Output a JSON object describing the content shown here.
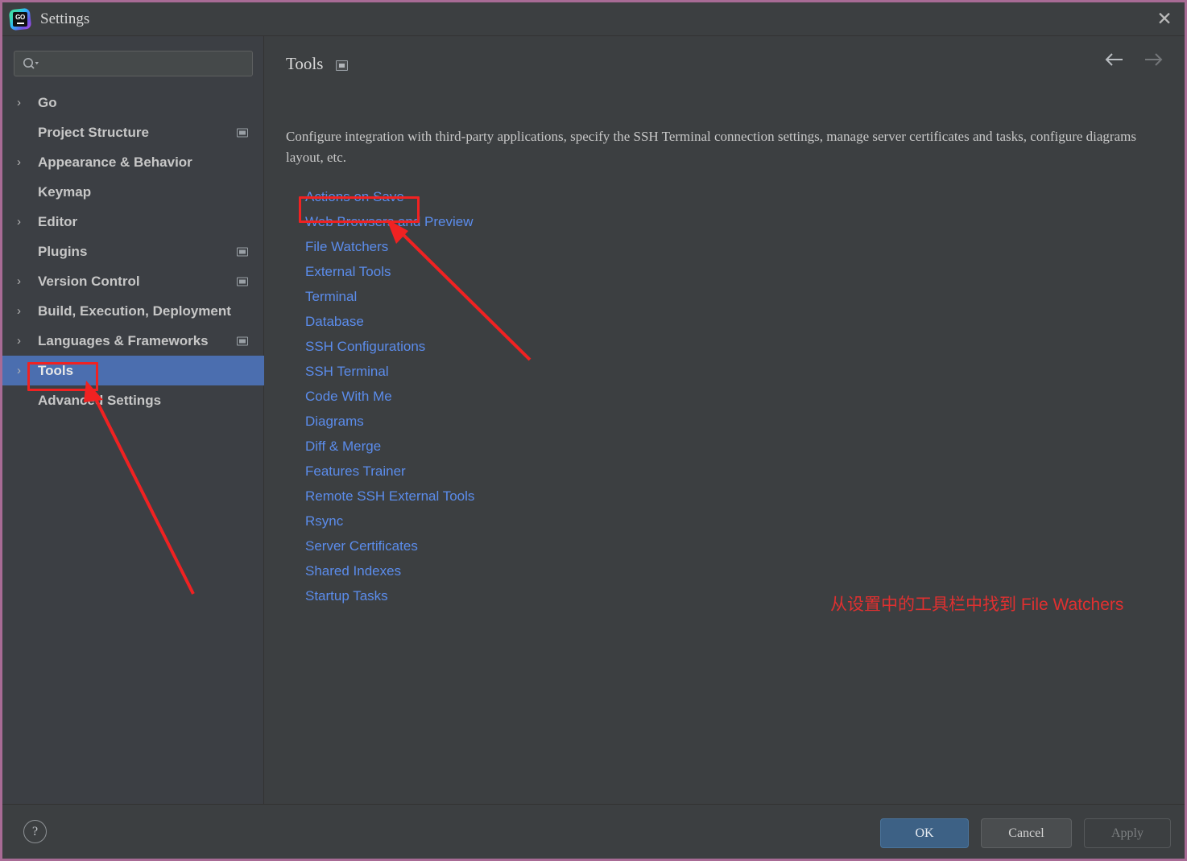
{
  "window": {
    "title": "Settings",
    "logo_text": "GO",
    "close_label": "✕"
  },
  "search": {
    "value": "",
    "placeholder": "",
    "icon": "search-icon"
  },
  "sidebar": {
    "items": [
      {
        "label": "Go",
        "expandable": true,
        "chevron": "›",
        "has_project_icon": false,
        "selected": false
      },
      {
        "label": "Project Structure",
        "expandable": false,
        "chevron": "",
        "has_project_icon": true,
        "selected": false
      },
      {
        "label": "Appearance & Behavior",
        "expandable": true,
        "chevron": "›",
        "has_project_icon": false,
        "selected": false
      },
      {
        "label": "Keymap",
        "expandable": false,
        "chevron": "",
        "has_project_icon": false,
        "selected": false
      },
      {
        "label": "Editor",
        "expandable": true,
        "chevron": "›",
        "has_project_icon": false,
        "selected": false
      },
      {
        "label": "Plugins",
        "expandable": false,
        "chevron": "",
        "has_project_icon": true,
        "selected": false
      },
      {
        "label": "Version Control",
        "expandable": true,
        "chevron": "›",
        "has_project_icon": true,
        "selected": false
      },
      {
        "label": "Build, Execution, Deployment",
        "expandable": true,
        "chevron": "›",
        "has_project_icon": false,
        "selected": false
      },
      {
        "label": "Languages & Frameworks",
        "expandable": true,
        "chevron": "›",
        "has_project_icon": true,
        "selected": false
      },
      {
        "label": "Tools",
        "expandable": true,
        "chevron": "›",
        "has_project_icon": false,
        "selected": true
      },
      {
        "label": "Advanced Settings",
        "expandable": false,
        "chevron": "",
        "has_project_icon": false,
        "selected": false
      }
    ]
  },
  "main": {
    "title": "Tools",
    "description": "Configure integration with third-party applications, specify the SSH Terminal connection settings, manage server certificates and tasks, configure diagrams layout, etc.",
    "back_arrow": "back-arrow-icon",
    "forward_arrow": "forward-arrow-icon",
    "links": [
      "Actions on Save",
      "Web Browsers and Preview",
      "File Watchers",
      "External Tools",
      "Terminal",
      "Database",
      "SSH Configurations",
      "SSH Terminal",
      "Code With Me",
      "Diagrams",
      "Diff & Merge",
      "Features Trainer",
      "Remote SSH External Tools",
      "Rsync",
      "Server Certificates",
      "Shared Indexes",
      "Startup Tasks"
    ]
  },
  "annotation": {
    "text": "从设置中的工具栏中找到 File Watchers",
    "color": "#e03030"
  },
  "footer": {
    "help_label": "?",
    "ok_label": "OK",
    "cancel_label": "Cancel",
    "apply_label": "Apply"
  },
  "colors": {
    "window_bg": "#3c3f41",
    "sidebar_bg": "#3c3f44",
    "selection": "#4b6eaf",
    "link": "#5b8ceb",
    "annotation_red": "#f02222",
    "window_border": "#a86b95",
    "ok_button": "#3d6185"
  }
}
